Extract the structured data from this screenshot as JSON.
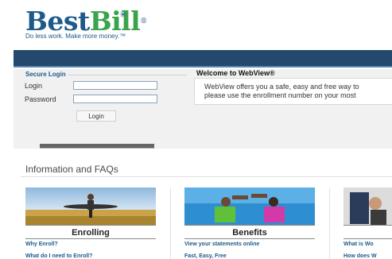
{
  "brand": {
    "name_part1": "Best",
    "name_part2": "Bill",
    "registered_mark": "®",
    "tagline": "Do less work. Make more money.™"
  },
  "login": {
    "legend": "Secure Login",
    "login_label": "Login",
    "password_label": "Password",
    "login_value": "",
    "password_value": "",
    "submit_label": "Login"
  },
  "welcome": {
    "title": "Welcome to WebView®",
    "line1": "WebView offers you a safe, easy and free way to",
    "line2": "please use the enrollment number on your most"
  },
  "info": {
    "title": "Information and FAQs",
    "columns": [
      {
        "heading": "Enrolling",
        "links": [
          "Why Enroll?",
          "What do I need to Enroll?"
        ]
      },
      {
        "heading": "Benefits",
        "links": [
          "View your statements online",
          "Fast, Easy, Free"
        ]
      },
      {
        "heading": "",
        "links": [
          "What is Wo",
          "How does W"
        ]
      }
    ]
  },
  "colors": {
    "brand_blue": "#1d5a8a",
    "brand_green": "#3aa44a",
    "header_bar": "#234a6d"
  }
}
